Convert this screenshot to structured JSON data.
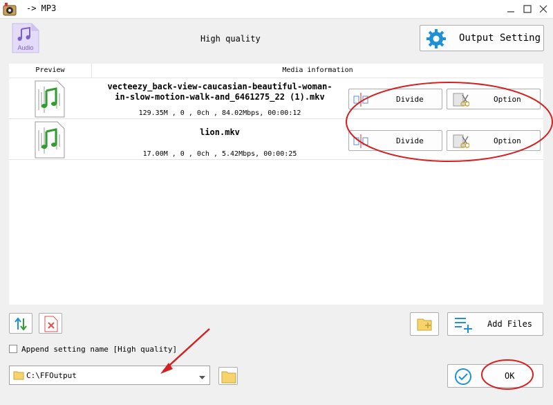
{
  "window": {
    "title": "-> MP3"
  },
  "header": {
    "format_badge": "Audio",
    "quality": "High quality",
    "output_setting_label": "Output Setting"
  },
  "table": {
    "headers": {
      "preview": "Preview",
      "media_info": "Media information"
    },
    "rows": [
      {
        "name_line1": "vecteezy_back-view-caucasian-beautiful-woman-",
        "name_line2": "in-slow-motion-walk-and_6461275_22 (1).mkv",
        "meta": "129.35M , 0 , 0ch , 84.02Mbps, 00:00:12",
        "divide_label": "Divide",
        "option_label": "Option"
      },
      {
        "name_line1": "lion.mkv",
        "name_line2": "",
        "meta": "17.00M , 0 , 0ch , 5.42Mbps, 00:00:25",
        "divide_label": "Divide",
        "option_label": "Option"
      }
    ]
  },
  "footer": {
    "add_files_label": "Add Files",
    "append_label": "Append setting name [High quality]",
    "output_path": "C:\\FFOutput",
    "ok_label": "OK"
  },
  "colors": {
    "accent_blue": "#1e90d6",
    "annotation_red": "#d42020",
    "folder_yellow": "#f2c14e"
  }
}
